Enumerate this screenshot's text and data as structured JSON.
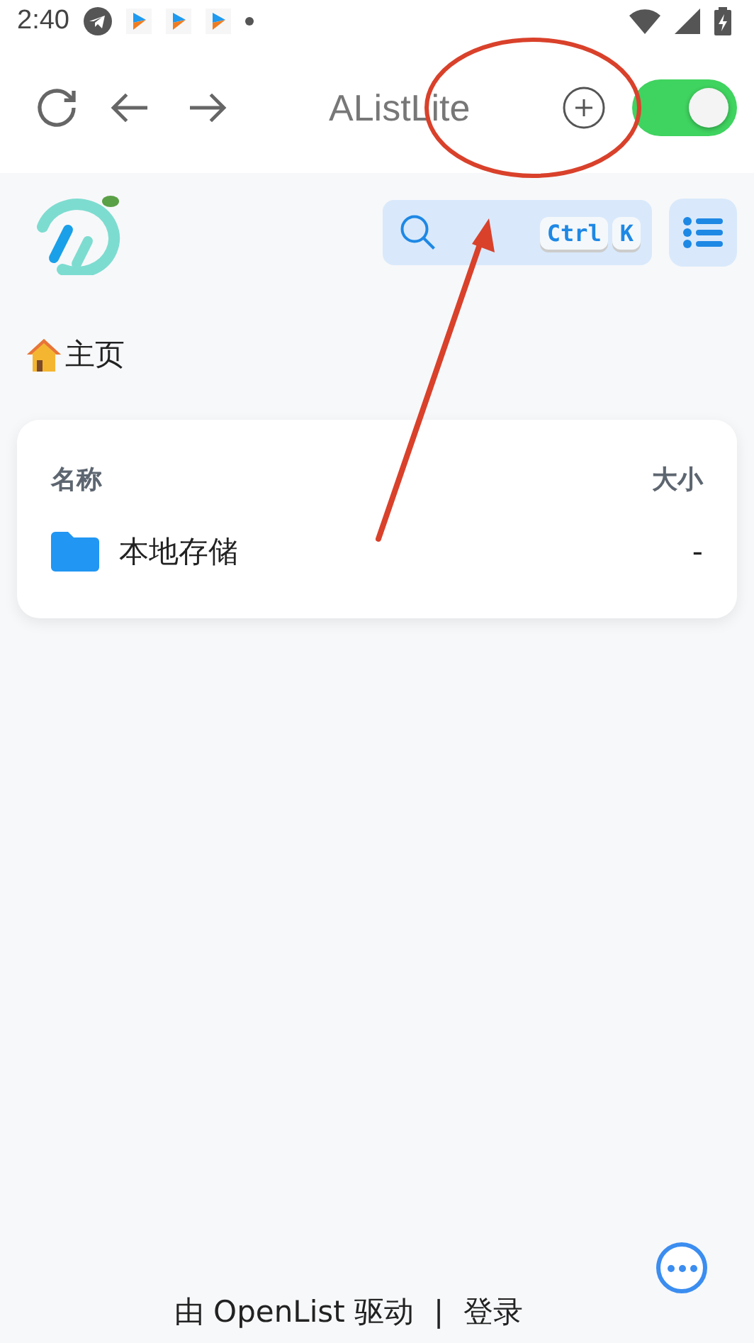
{
  "status_bar": {
    "time": "2:40"
  },
  "toolbar": {
    "title": "AListLite",
    "toggle": {
      "on": true
    }
  },
  "search": {
    "keys": [
      "Ctrl",
      "K"
    ]
  },
  "breadcrumb": {
    "label": "主页"
  },
  "table": {
    "columns": [
      "名称",
      "大小"
    ],
    "rows": [
      {
        "name": "本地存储",
        "size": "-"
      }
    ]
  },
  "footer": {
    "powered": "由 OpenList 驱动",
    "separator": "|",
    "login": "登录"
  }
}
